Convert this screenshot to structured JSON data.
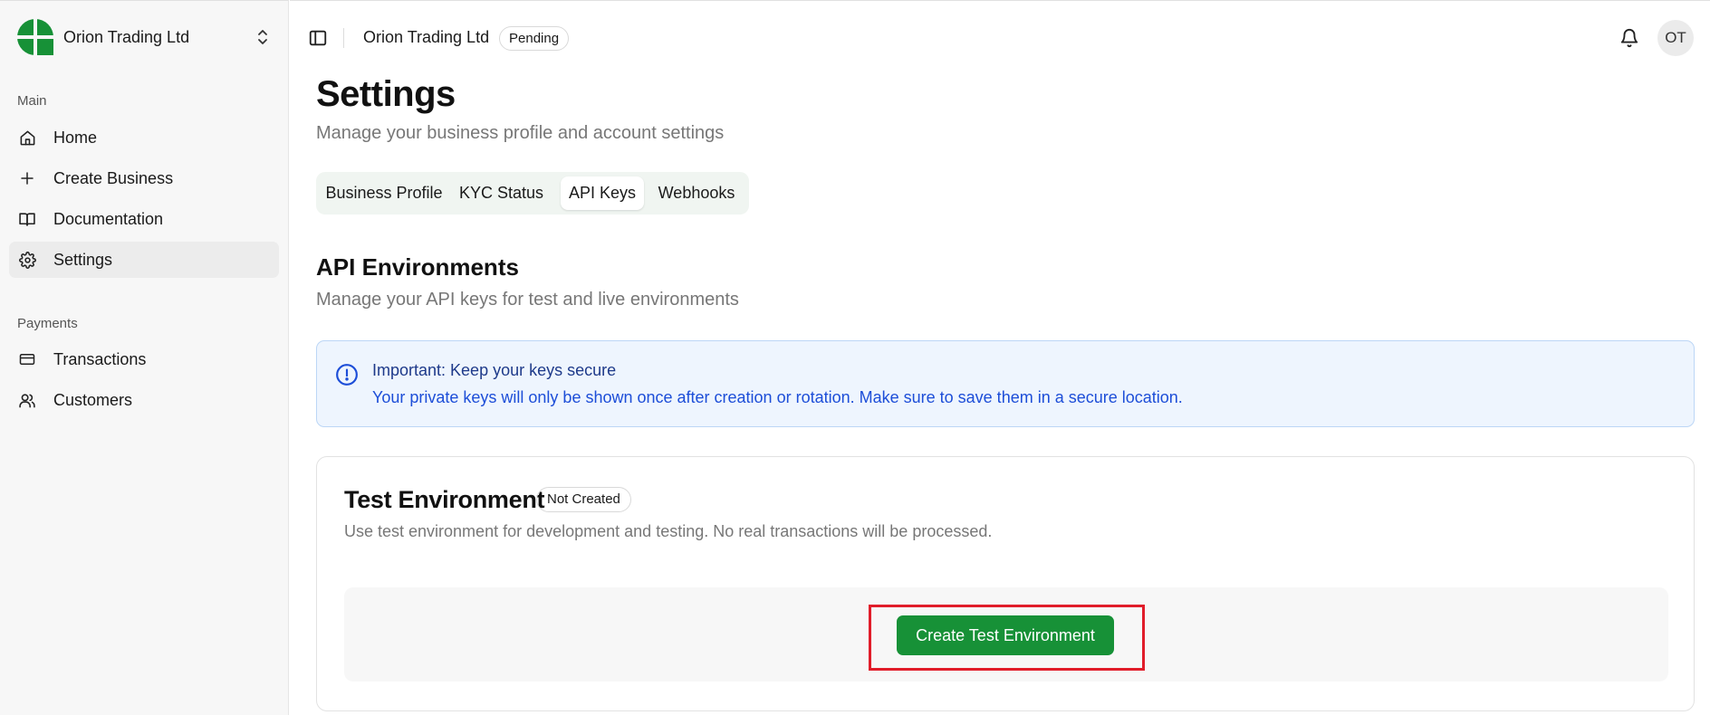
{
  "sidebar": {
    "brand_name": "Orion Trading Ltd",
    "sections": [
      {
        "label": "Main"
      },
      {
        "label": "Payments"
      }
    ],
    "items": [
      {
        "label": "Home",
        "icon": "home-icon"
      },
      {
        "label": "Create Business",
        "icon": "plus-icon"
      },
      {
        "label": "Documentation",
        "icon": "book-icon"
      },
      {
        "label": "Settings",
        "icon": "gear-icon",
        "active": true
      },
      {
        "label": "Transactions",
        "icon": "credit-card-icon"
      },
      {
        "label": "Customers",
        "icon": "users-icon"
      }
    ]
  },
  "header": {
    "business_name": "Orion Trading Ltd",
    "status_badge": "Pending",
    "avatar_initials": "OT"
  },
  "main": {
    "title": "Settings",
    "subtitle": "Manage your business profile and account settings",
    "tabs": [
      {
        "label": "Business Profile"
      },
      {
        "label": "KYC Status"
      },
      {
        "label": "API Keys",
        "active": true
      },
      {
        "label": "Webhooks"
      }
    ],
    "section_title": "API Environments",
    "section_subtitle": "Manage your API keys for test and live environments",
    "alert": {
      "title": "Important: Keep your keys secure",
      "description": "Your private keys will only be shown once after creation or rotation. Make sure to save them in a secure location."
    },
    "test_environment": {
      "title": "Test Environment",
      "badge": "Not Created",
      "description": "Use test environment for development and testing. No real transactions will be processed.",
      "button_label": "Create Test Environment"
    }
  },
  "colors": {
    "brand_green": "#179137",
    "alert_bg": "#eef5fe",
    "alert_text": "#1d4ed8",
    "highlight_red": "#e11d2a"
  }
}
